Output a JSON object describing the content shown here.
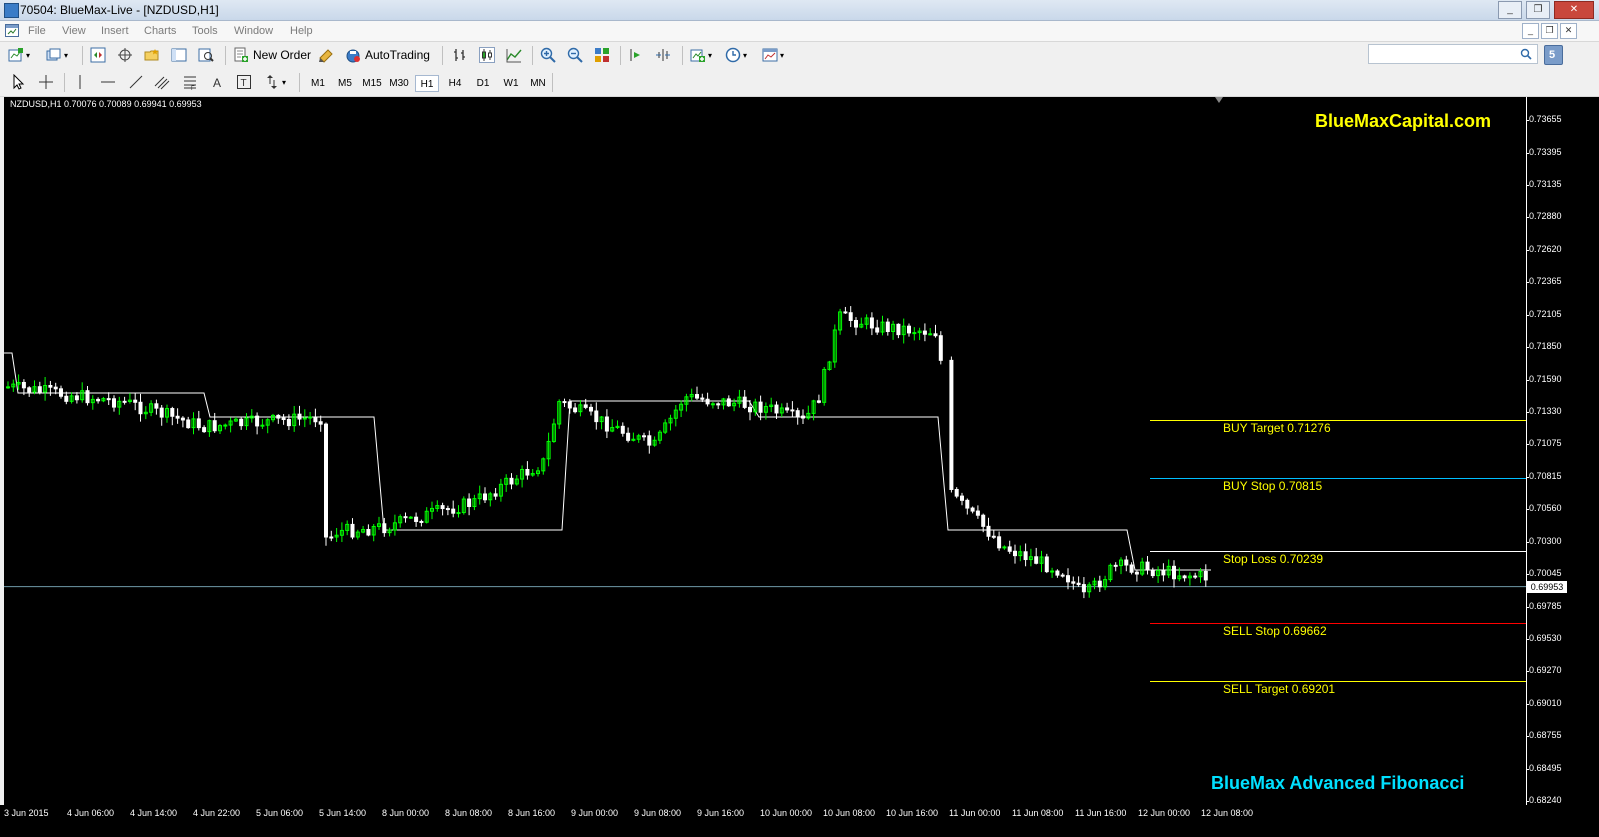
{
  "window": {
    "title": "70504: BlueMax-Live - [NZDUSD,H1]",
    "minimize": "_",
    "maximize": "❐",
    "close": "✕"
  },
  "menu": [
    "File",
    "View",
    "Insert",
    "Charts",
    "Tools",
    "Window",
    "Help"
  ],
  "toolbar": {
    "new_order": "New Order",
    "autotrading": "AutoTrading",
    "timeframes": [
      "M1",
      "M5",
      "M15",
      "M30",
      "H1",
      "H4",
      "D1",
      "W1",
      "MN"
    ],
    "active_timeframe": "H1",
    "search_placeholder": ""
  },
  "chart": {
    "symbol_info": "NZDUSD,H1  0.70076 0.70089 0.69941 0.69953",
    "brand": "BlueMaxCapital.com",
    "indicator_name": "BlueMax Advanced Fibonacci",
    "current_price": "0.69953",
    "current_price_value": 0.69953,
    "colors": {
      "background": "#000000",
      "bull_candle": "#00ff00",
      "bear_candle": "#ffffff",
      "trend_line": "#ffffff",
      "current_price_line": "#6f9aa8",
      "buy_target": "#ffff00",
      "buy_stop": "#00bfff",
      "stop_loss": "#ffffff",
      "sell_stop": "#ff0000",
      "sell_target": "#ffff00"
    },
    "price_ticks": [
      "0.73655",
      "0.73395",
      "0.73135",
      "0.72880",
      "0.72620",
      "0.72365",
      "0.72105",
      "0.71850",
      "0.71590",
      "0.71330",
      "0.71075",
      "0.70815",
      "0.70560",
      "0.70300",
      "0.70045",
      "0.69785",
      "0.69530",
      "0.69270",
      "0.69010",
      "0.68755",
      "0.68495",
      "0.68240"
    ],
    "time_ticks": [
      "3 Jun 2015",
      "4 Jun 06:00",
      "4 Jun 14:00",
      "4 Jun 22:00",
      "5 Jun 06:00",
      "5 Jun 14:00",
      "8 Jun 00:00",
      "8 Jun 08:00",
      "8 Jun 16:00",
      "9 Jun 00:00",
      "9 Jun 08:00",
      "9 Jun 16:00",
      "10 Jun 00:00",
      "10 Jun 08:00",
      "10 Jun 16:00",
      "11 Jun 00:00",
      "11 Jun 08:00",
      "11 Jun 16:00",
      "12 Jun 00:00",
      "12 Jun 08:00"
    ],
    "fib_levels": [
      {
        "label": "BUY Target  0.71276",
        "price": 0.71276,
        "color": "#ffff00"
      },
      {
        "label": "BUY Stop   0.70815",
        "price": 0.70815,
        "color": "#00bfff"
      },
      {
        "label": "Stop Loss   0.70239",
        "price": 0.70239,
        "color": "#ffffff"
      },
      {
        "label": "SELL Stop   0.69662",
        "price": 0.69662,
        "color": "#ff0000"
      },
      {
        "label": "SELL Target 0.69201",
        "price": 0.69201,
        "color": "#ffff00"
      }
    ]
  }
}
